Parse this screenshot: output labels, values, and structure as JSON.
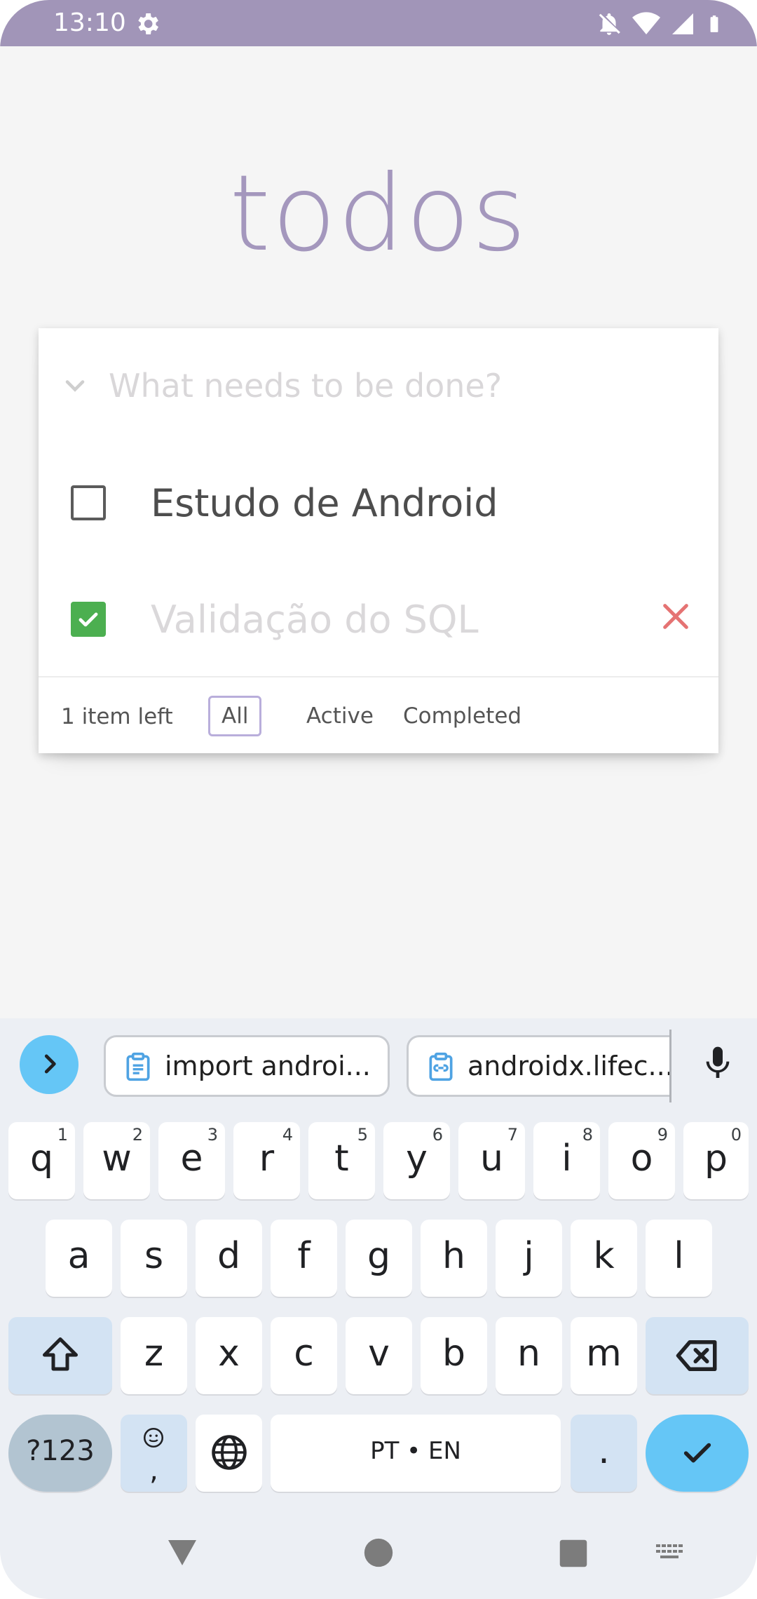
{
  "status_bar": {
    "time": "13:10",
    "icons": [
      "gear-icon",
      "bell-off-icon",
      "wifi-icon",
      "signal-icon",
      "battery-icon"
    ]
  },
  "app": {
    "title": "todos",
    "new_todo_placeholder": "What needs to be done?",
    "todos": [
      {
        "title": "Estudo de Android",
        "completed": false
      },
      {
        "title": "Validação do SQL",
        "completed": true
      }
    ],
    "footer": {
      "count": "1 item left",
      "filters": [
        "All",
        "Active",
        "Completed"
      ],
      "selected_filter": "All"
    }
  },
  "keyboard": {
    "suggestions": [
      "import androi...",
      "androidx.lifec..."
    ],
    "rows": [
      [
        {
          "key": "q",
          "hint": "1"
        },
        {
          "key": "w",
          "hint": "2"
        },
        {
          "key": "e",
          "hint": "3"
        },
        {
          "key": "r",
          "hint": "4"
        },
        {
          "key": "t",
          "hint": "5"
        },
        {
          "key": "y",
          "hint": "6"
        },
        {
          "key": "u",
          "hint": "7"
        },
        {
          "key": "i",
          "hint": "8"
        },
        {
          "key": "o",
          "hint": "9"
        },
        {
          "key": "p",
          "hint": "0"
        }
      ],
      [
        {
          "key": "a"
        },
        {
          "key": "s"
        },
        {
          "key": "d"
        },
        {
          "key": "f"
        },
        {
          "key": "g"
        },
        {
          "key": "h"
        },
        {
          "key": "j"
        },
        {
          "key": "k"
        },
        {
          "key": "l"
        }
      ],
      [
        {
          "key": "z"
        },
        {
          "key": "x"
        },
        {
          "key": "c"
        },
        {
          "key": "v"
        },
        {
          "key": "b"
        },
        {
          "key": "n"
        },
        {
          "key": "m"
        }
      ]
    ],
    "symbols_key": "?123",
    "emoji_key_comma": ",",
    "space_label": "PT • EN",
    "period_key": "."
  },
  "colors": {
    "status_bar": "#a195b8",
    "title": "#a497bd",
    "checked": "#4caf50",
    "destroy": "#e57373",
    "accent_key": "#65c6f6"
  }
}
